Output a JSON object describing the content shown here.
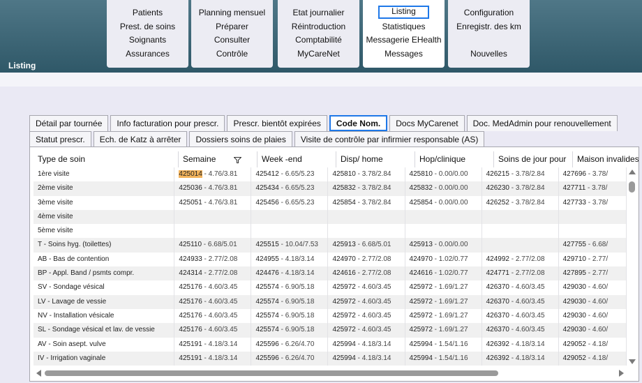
{
  "app": {
    "title": "Listing"
  },
  "menu": {
    "groups": [
      {
        "items": [
          "Patients",
          "Prest. de soins",
          "Soignants",
          "Assurances"
        ]
      },
      {
        "items": [
          "Planning mensuel",
          "Préparer",
          "Consulter",
          "Contrôle"
        ]
      },
      {
        "items": [
          "Etat journalier",
          "Réintroduction",
          "Comptabilité",
          "MyCareNet"
        ]
      },
      {
        "items": [
          "Listing",
          "Statistiques",
          "Messagerie EHealth",
          "Messages"
        ]
      },
      {
        "items": [
          "Configuration",
          "Enregistr. des km",
          "",
          "Nouvelles"
        ]
      }
    ],
    "active_group": 3,
    "selected_item": "Listing"
  },
  "tabs": {
    "row1": [
      "Détail par tournée",
      "Info facturation pour prescr.",
      "Prescr. bientôt expirées",
      "Code Nom.",
      "Docs MyCarenet",
      "Doc. MedAdmin pour renouvellement"
    ],
    "row2": [
      "Statut prescr.",
      "Ech. de Katz à arrêter",
      "Dossiers soins de plaies",
      "Visite de contrôle par infirmier responsable (AS)"
    ],
    "active": "Code Nom."
  },
  "table": {
    "columns": [
      "Type de soin",
      "Semaine",
      "Week -end",
      "Disp/ home",
      "Hop/clinique",
      "Soins de jour pour",
      "Maison invalides"
    ],
    "highlighted_code": "425014",
    "rows": [
      {
        "type": "1ère visite",
        "cells": [
          [
            "425014",
            "4.76/3.81"
          ],
          [
            "425412",
            "6.65/5.23"
          ],
          [
            "425810",
            "3.78/2.84"
          ],
          [
            "425810",
            "0.00/0.00"
          ],
          [
            "426215",
            "3.78/2.84"
          ],
          [
            "427696",
            "3.78/"
          ]
        ]
      },
      {
        "type": "2ème visite",
        "cells": [
          [
            "425036",
            "4.76/3.81"
          ],
          [
            "425434",
            "6.65/5.23"
          ],
          [
            "425832",
            "3.78/2.84"
          ],
          [
            "425832",
            "0.00/0.00"
          ],
          [
            "426230",
            "3.78/2.84"
          ],
          [
            "427711",
            "3.78/"
          ]
        ]
      },
      {
        "type": "3ème visite",
        "cells": [
          [
            "425051",
            "4.76/3.81"
          ],
          [
            "425456",
            "6.65/5.23"
          ],
          [
            "425854",
            "3.78/2.84"
          ],
          [
            "425854",
            "0.00/0.00"
          ],
          [
            "426252",
            "3.78/2.84"
          ],
          [
            "427733",
            "3.78/"
          ]
        ]
      },
      {
        "type": "4ème visite",
        "cells": [
          null,
          null,
          null,
          null,
          null,
          null
        ]
      },
      {
        "type": "5ème visite",
        "cells": [
          null,
          null,
          null,
          null,
          null,
          null
        ]
      },
      {
        "type": "T - Soins hyg. (toilettes)",
        "cells": [
          [
            "425110",
            "6.68/5.01"
          ],
          [
            "425515",
            "10.04/7.53"
          ],
          [
            "425913",
            "6.68/5.01"
          ],
          [
            "425913",
            "0.00/0.00"
          ],
          null,
          [
            "427755",
            "6.68/"
          ]
        ]
      },
      {
        "type": "AB - Bas de contention",
        "cells": [
          [
            "424933",
            "2.77/2.08"
          ],
          [
            "424955",
            "4.18/3.14"
          ],
          [
            "424970",
            "2.77/2.08"
          ],
          [
            "424970",
            "1.02/0.77"
          ],
          [
            "424992",
            "2.77/2.08"
          ],
          [
            "429710",
            "2.77/"
          ]
        ]
      },
      {
        "type": "BP - Appl. Band / psmts compr.",
        "cells": [
          [
            "424314",
            "2.77/2.08"
          ],
          [
            "424476",
            "4.18/3.14"
          ],
          [
            "424616",
            "2.77/2.08"
          ],
          [
            "424616",
            "1.02/0.77"
          ],
          [
            "424771",
            "2.77/2.08"
          ],
          [
            "427895",
            "2.77/"
          ]
        ]
      },
      {
        "type": "SV - Sondage vésical",
        "cells": [
          [
            "425176",
            "4.60/3.45"
          ],
          [
            "425574",
            "6.90/5.18"
          ],
          [
            "425972",
            "4.60/3.45"
          ],
          [
            "425972",
            "1.69/1.27"
          ],
          [
            "426370",
            "4.60/3.45"
          ],
          [
            "429030",
            "4.60/"
          ]
        ]
      },
      {
        "type": "LV - Lavage de vessie",
        "cells": [
          [
            "425176",
            "4.60/3.45"
          ],
          [
            "425574",
            "6.90/5.18"
          ],
          [
            "425972",
            "4.60/3.45"
          ],
          [
            "425972",
            "1.69/1.27"
          ],
          [
            "426370",
            "4.60/3.45"
          ],
          [
            "429030",
            "4.60/"
          ]
        ]
      },
      {
        "type": "NV - Installation vésicale",
        "cells": [
          [
            "425176",
            "4.60/3.45"
          ],
          [
            "425574",
            "6.90/5.18"
          ],
          [
            "425972",
            "4.60/3.45"
          ],
          [
            "425972",
            "1.69/1.27"
          ],
          [
            "426370",
            "4.60/3.45"
          ],
          [
            "429030",
            "4.60/"
          ]
        ]
      },
      {
        "type": "SL - Sondage vésical et lav. de vessie",
        "cells": [
          [
            "425176",
            "4.60/3.45"
          ],
          [
            "425574",
            "6.90/5.18"
          ],
          [
            "425972",
            "4.60/3.45"
          ],
          [
            "425972",
            "1.69/1.27"
          ],
          [
            "426370",
            "4.60/3.45"
          ],
          [
            "429030",
            "4.60/"
          ]
        ]
      },
      {
        "type": "AV - Soin asept. vulve",
        "cells": [
          [
            "425191",
            "4.18/3.14"
          ],
          [
            "425596",
            "6.26/4.70"
          ],
          [
            "425994",
            "4.18/3.14"
          ],
          [
            "425994",
            "1.54/1.16"
          ],
          [
            "426392",
            "4.18/3.14"
          ],
          [
            "429052",
            "4.18/"
          ]
        ]
      },
      {
        "type": "IV - Irrigation vaginale",
        "cells": [
          [
            "425191",
            "4.18/3.14"
          ],
          [
            "425596",
            "6.26/4.70"
          ],
          [
            "425994",
            "4.18/3.14"
          ],
          [
            "425994",
            "1.54/1.16"
          ],
          [
            "426392",
            "4.18/3.14"
          ],
          [
            "429052",
            "4.18/"
          ]
        ]
      }
    ]
  }
}
